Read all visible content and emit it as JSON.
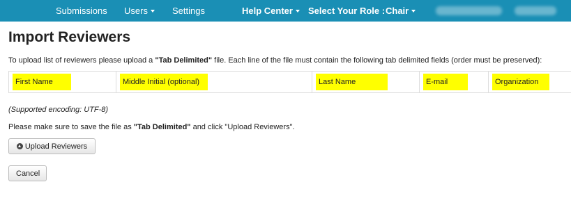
{
  "nav": {
    "submissions": "Submissions",
    "users": "Users",
    "settings": "Settings",
    "help_center": "Help Center",
    "select_role_label": "Select Your Role :",
    "role": "Chair"
  },
  "page": {
    "title": "Import Reviewers",
    "instruction_before": "To upload list of reviewers please upload a ",
    "instruction_bold": "\"Tab Delimited\"",
    "instruction_after": " file. Each line of the file must contain the following tab delimited fields (order must be preserved):",
    "fields": [
      "First Name",
      "Middle Initial (optional)",
      "Last Name",
      "E-mail",
      "Organization"
    ],
    "encoding": "(Supported encoding: UTF-8)",
    "note_before": "Please make sure to save the file as ",
    "note_bold": "\"Tab Delimited\"",
    "note_after": " and click \"Upload Reviewers\".",
    "upload_button": "Upload Reviewers",
    "cancel_button": "Cancel"
  },
  "colors": {
    "navbar": "#1a8fb5",
    "highlight": "#ffff00"
  }
}
